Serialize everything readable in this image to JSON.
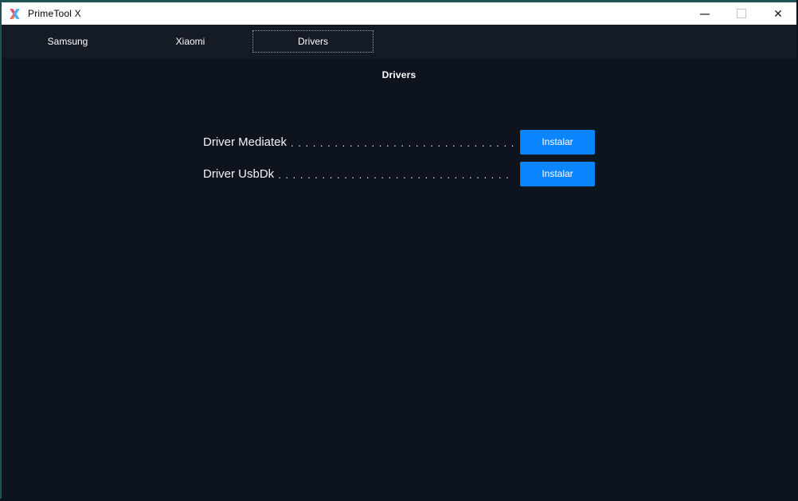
{
  "window": {
    "title": "PrimeTool X",
    "accent_border_color": "#1d5254",
    "controls": {
      "minimize_glyph": "—",
      "close_glyph": "✕"
    }
  },
  "tabs": [
    {
      "label": "Samsung",
      "active": false
    },
    {
      "label": "Xiaomi",
      "active": false
    },
    {
      "label": "Drivers",
      "active": true
    }
  ],
  "page": {
    "heading": "Drivers"
  },
  "drivers": [
    {
      "label": "Driver Mediatek",
      "dots": ". . . . . . . . . . . . . . . . . . . . . . . . . . . . . . . . . . . . . . . . . . . .",
      "button_label": "Instalar"
    },
    {
      "label": "Driver UsbDk",
      "dots": ". . . . . . . . . . . . . . . . . . . . . . . . . . . . . . . . . . . . . . . . . . . .",
      "button_label": "Instalar"
    }
  ],
  "colors": {
    "titlebar_bg": "#ffffff",
    "tabbar_bg": "#151b24",
    "content_bg": "#0e141d",
    "accent_button": "#0a84ff",
    "text_light": "#ffffff"
  }
}
